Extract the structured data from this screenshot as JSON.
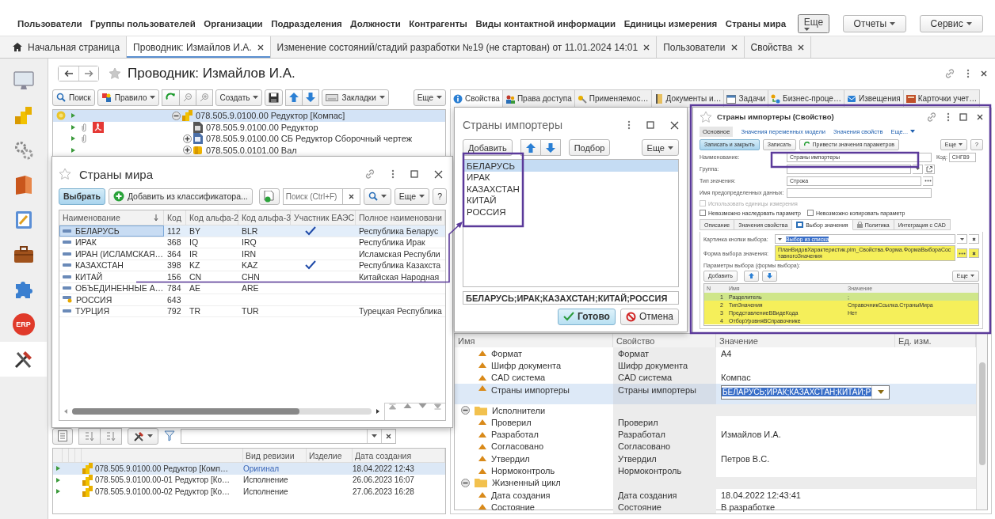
{
  "menu": {
    "items": [
      "Пользователи",
      "Группы пользователей",
      "Организации",
      "Подразделения",
      "Должности",
      "Контрагенты",
      "Виды контактной информации",
      "Единицы измерения",
      "Страны мира"
    ],
    "more": "Еще",
    "buttons": [
      "Отчеты",
      "Сервис"
    ]
  },
  "tabs": [
    {
      "label": "Начальная страница",
      "selected": false,
      "kind": "home"
    },
    {
      "label": "Проводник: Измайлов И.А.",
      "selected": true,
      "kind": "page"
    },
    {
      "label": "Изменение состояний/стадий разработки №19 (не стартован) от 11.01.2024 14:01",
      "selected": false,
      "kind": "page"
    },
    {
      "label": "Пользователи",
      "selected": false,
      "kind": "page"
    },
    {
      "label": "Свойства",
      "selected": false,
      "kind": "page"
    }
  ],
  "sidebar": [
    {
      "kind": "monitor",
      "selected": false
    },
    {
      "kind": "coins",
      "selected": false
    },
    {
      "kind": "gears",
      "selected": false
    },
    {
      "kind": "book",
      "selected": false
    },
    {
      "kind": "notepad",
      "selected": false
    },
    {
      "kind": "briefcase",
      "selected": false
    },
    {
      "kind": "puzzle",
      "selected": false
    },
    {
      "kind": "badge",
      "label": "ERP",
      "selected": false
    },
    {
      "kind": "tools",
      "selected": true
    }
  ],
  "document": {
    "title": "Проводник: Измайлов И.А.",
    "toolbar": {
      "search": "Поиск",
      "rule": "Правило",
      "create": "Создать",
      "bookmarks": "Закладки",
      "more": "Еще"
    },
    "tree": [
      {
        "label": "078.505.9.0100.00 Редуктор [Компас]",
        "kind": "assembly",
        "selected": true,
        "has_children": true,
        "expanded": true,
        "status": true,
        "attached_file": false,
        "pdf": false,
        "children": [
          {
            "label": "078.505.9.0100.00 Редуктор",
            "kind": "document",
            "selected": false,
            "has_children": false,
            "status": false,
            "attached_file": true,
            "pdf": true
          },
          {
            "label": "078.505.9.0100.00 СБ Редуктор Сборочный чертеж",
            "kind": "drawing",
            "selected": false,
            "has_children": true,
            "expanded": false,
            "status": false,
            "attached_file": true,
            "pdf": false
          },
          {
            "label": "078.505.0.0101.00 Вал",
            "kind": "part",
            "selected": false,
            "has_children": true,
            "expanded": false,
            "status": false,
            "attached_file": false,
            "pdf": false
          }
        ]
      }
    ]
  },
  "revisions": {
    "columns": [
      "Вид ревизии",
      "Изделие",
      "Дата создания"
    ],
    "rows": [
      {
        "name": "078.505.9.0100.00 Редуктор [Комп…",
        "revision": "Оригинал",
        "link": true,
        "date": "18.04.2022 12:43",
        "selected": true
      },
      {
        "name": "078.505.9.0100.00-01 Редуктор [Ко…",
        "revision": "Исполнение",
        "link": false,
        "date": "26.06.2023 16:07",
        "selected": false
      },
      {
        "name": "078.505.9.0100.00-02 Редуктор [Ко…",
        "revision": "Исполнение",
        "link": false,
        "date": "27.06.2023 16:28",
        "selected": false
      }
    ]
  },
  "countries_dialog": {
    "title": "Страны мира",
    "select": "Выбрать",
    "add": "Добавить из классификатора...",
    "search_placeholder": "Поиск (Ctrl+F)",
    "more": "Еще",
    "help": "?",
    "columns": [
      "Наименование",
      "Код",
      "Код альфа-2",
      "Код альфа-3",
      "Участник ЕАЭС",
      "Полное наименовани"
    ],
    "rows": [
      {
        "name": "БЕЛАРУСЬ",
        "code": "112",
        "alpha2": "BY",
        "alpha3": "BLR",
        "eaeu": true,
        "full": "Республика Беларус",
        "kind": "item",
        "selected": true
      },
      {
        "name": "ИРАК",
        "code": "368",
        "alpha2": "IQ",
        "alpha3": "IRQ",
        "eaeu": false,
        "full": "Республика Ирак",
        "kind": "item",
        "selected": false
      },
      {
        "name": "ИРАН (ИСЛАМСКАЯ…",
        "code": "364",
        "alpha2": "IR",
        "alpha3": "IRN",
        "eaeu": false,
        "full": "Исламская Республи",
        "kind": "item",
        "selected": false
      },
      {
        "name": "КАЗАХСТАН",
        "code": "398",
        "alpha2": "KZ",
        "alpha3": "KAZ",
        "eaeu": true,
        "full": "Республика Казахста",
        "kind": "item",
        "selected": false
      },
      {
        "name": "КИТАЙ",
        "code": "156",
        "alpha2": "CN",
        "alpha3": "CHN",
        "eaeu": false,
        "full": "Китайская Народная",
        "kind": "item",
        "selected": false
      },
      {
        "name": "ОБЪЕДИНЕННЫЕ А…",
        "code": "784",
        "alpha2": "AE",
        "alpha3": "ARE",
        "eaeu": false,
        "kind": "item",
        "selected": false
      },
      {
        "name": "РОССИЯ",
        "code": "643",
        "eaeu": false,
        "kind": "predefined",
        "selected": false
      },
      {
        "name": "ТУРЦИЯ",
        "code": "792",
        "alpha2": "TR",
        "alpha3": "TUR",
        "eaeu": false,
        "full": "Турецкая Республика",
        "kind": "item",
        "selected": false
      }
    ]
  },
  "properties_tabs": [
    {
      "label": "Свойства",
      "kind": "info",
      "selected": true
    },
    {
      "label": "Права доступа",
      "kind": "users",
      "selected": false
    },
    {
      "label": "Применяемос…",
      "kind": "key",
      "selected": false
    },
    {
      "label": "Документы и…",
      "kind": "binder",
      "selected": false
    },
    {
      "label": "Задачи",
      "kind": "calendar",
      "selected": false
    },
    {
      "label": "Бизнес-проце…",
      "kind": "workflow",
      "selected": false
    },
    {
      "label": "Извещения",
      "kind": "notice",
      "selected": false
    },
    {
      "label": "Карточки учет…",
      "kind": "card",
      "selected": false
    }
  ],
  "importers_dialog": {
    "title": "Страны импортеры",
    "add": "Добавить",
    "pick": "Подбор",
    "more": "Еще",
    "items": [
      {
        "label": "БЕЛАРУСЬ",
        "selected": true
      },
      {
        "label": "ИРАК",
        "selected": false
      },
      {
        "label": "КАЗАХСТАН",
        "selected": false
      },
      {
        "label": "КИТАЙ",
        "selected": false
      },
      {
        "label": "РОССИЯ",
        "selected": false
      }
    ],
    "value": "БЕЛАРУСЬ;ИРАК;КАЗАХСТАН;КИТАЙ;РОССИЯ",
    "ok": "Готово",
    "cancel": "Отмена"
  },
  "property_dialog": {
    "title": "Страны импортеры (Свойство)",
    "nav": [
      {
        "label": "Основное",
        "selected": true
      },
      {
        "label": "Значения переменных модели",
        "selected": false
      },
      {
        "label": "Значения свойств",
        "selected": false
      },
      {
        "label": "Еще...",
        "selected": false
      }
    ],
    "buttons": {
      "save_close": "Записать и закрыть",
      "save": "Записать",
      "apply": "Привести значения параметров",
      "more": "Еще",
      "help": "?"
    },
    "fields": [
      {
        "label": "Наименование:",
        "value": "Страны импортеры",
        "kind": "text"
      },
      {
        "label": "Группа:",
        "kind": "select"
      },
      {
        "label": "Тип значения:",
        "value": "Строка",
        "kind": "choice"
      },
      {
        "label": "Имя предопределенных данных:",
        "kind": "text"
      }
    ],
    "code": {
      "label": "Код:",
      "value": "СНГ89"
    },
    "checkboxes": [
      {
        "label": "Использовать единицы измерения",
        "checked": false,
        "disabled": true
      },
      {
        "label": "Невозможно наследовать параметр",
        "checked": false,
        "disabled": false
      },
      {
        "label": "Невозможно копировать параметр",
        "checked": false,
        "disabled": false
      }
    ],
    "tabs": [
      {
        "label": "Описание",
        "kind": "plain",
        "selected": false
      },
      {
        "label": "Значения свойства",
        "kind": "plain",
        "selected": false
      },
      {
        "label": "Выбор значения",
        "kind": "picture",
        "selected": true
      },
      {
        "label": "Политика",
        "kind": "lock",
        "selected": false
      },
      {
        "label": "Интеграция с CAD",
        "kind": "plain",
        "selected": false
      }
    ],
    "choice_button": {
      "label": "Картинка кнопки выбора:",
      "value": "Выбор из списка",
      "text_selected": true
    },
    "choice_form": {
      "label": "Форма выбора значения:",
      "value": "ПланВидовХарактеристик.pim_Свойства.Форма.ФормаВыбораСоставногоЗначения",
      "highlighted": true
    },
    "params": {
      "label": "Параметры выбора (формы выбора):",
      "add": "Добавить",
      "more": "Еще",
      "columns": [
        "N",
        "Имя",
        "Значение"
      ],
      "rows": [
        {
          "n": "1",
          "name": "Разделитель",
          "value": ";",
          "selected": true,
          "highlighted": true
        },
        {
          "n": "2",
          "name": "ТипЗначения",
          "value": "СправочникСсылка.СтраныМира",
          "selected": false,
          "highlighted": true
        },
        {
          "n": "3",
          "name": "ПредставлениеВВидеКода",
          "value": "Нет",
          "selected": false,
          "highlighted": true
        },
        {
          "n": "4",
          "name": "ОтборУровняВСправочнике",
          "selected": false,
          "highlighted": true
        }
      ]
    }
  },
  "properties": {
    "columns": [
      "Имя",
      "Свойство",
      "Значение",
      "Ед. изм."
    ],
    "rows": [
      {
        "name": "Формат",
        "property": "Формат",
        "value": "A4",
        "kind": "property",
        "selected": false
      },
      {
        "name": "Шифр документа",
        "property": "Шифр документа",
        "kind": "property",
        "selected": false
      },
      {
        "name": "CAD система",
        "property": "CAD система",
        "value": "Компас",
        "kind": "property",
        "selected": false
      },
      {
        "name": "Страны импортеры",
        "property": "Страны импортеры",
        "value": "БЕЛАРУСЬ;ИРАК;КАЗАХСТАН;КИТАЙ;Р",
        "kind": "property",
        "selected": true
      },
      {
        "name": "Исполнители",
        "kind": "group",
        "expanded": true,
        "selected": false,
        "children": [
          {
            "name": "Проверил",
            "property": "Проверил",
            "kind": "property",
            "selected": false
          },
          {
            "name": "Разработал",
            "property": "Разработал",
            "value": "Измайлов И.А.",
            "kind": "property",
            "selected": false
          },
          {
            "name": "Согласовано",
            "property": "Согласовано",
            "kind": "property",
            "selected": false
          },
          {
            "name": "Утвердил",
            "property": "Утвердил",
            "value": "Петров В.С.",
            "kind": "property",
            "selected": false
          },
          {
            "name": "Нормоконтроль",
            "property": "Нормоконтроль",
            "kind": "property",
            "selected": false
          }
        ]
      },
      {
        "name": "Жизненный цикл",
        "kind": "group",
        "expanded": true,
        "selected": false,
        "children": [
          {
            "name": "Дата создания",
            "property": "Дата создания",
            "value": "18.04.2022 12:43:41",
            "kind": "property",
            "selected": false
          },
          {
            "name": "Состояние",
            "property": "Состояние",
            "value": "В разработке",
            "kind": "property",
            "selected": false
          }
        ]
      }
    ]
  }
}
